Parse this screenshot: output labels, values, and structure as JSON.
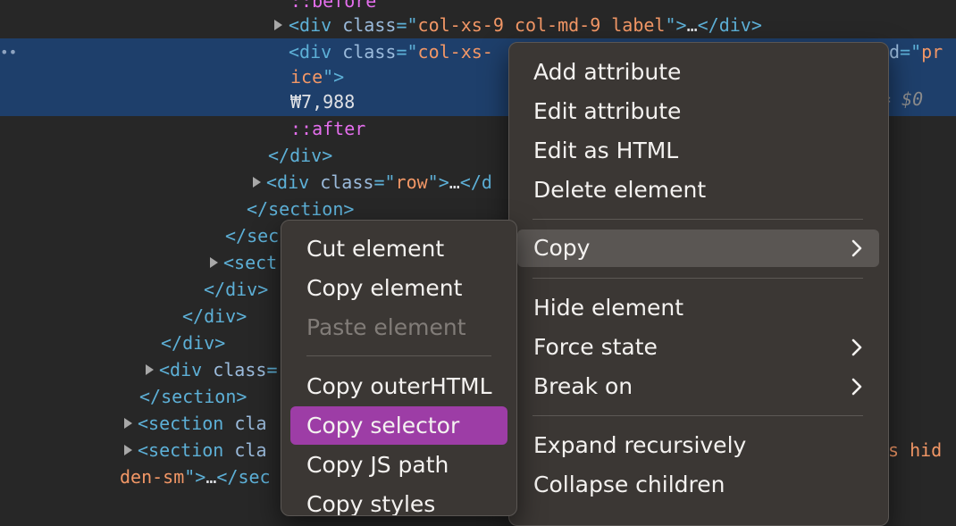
{
  "elements_tree": {
    "lines": [
      {
        "id": "l0",
        "segments": [
          {
            "t": "::before",
            "c": "pseudo"
          }
        ]
      },
      {
        "id": "l1",
        "segments": [
          {
            "t": "<div ",
            "c": "tag"
          },
          {
            "t": "class",
            "c": "attr"
          },
          {
            "t": "=\"",
            "c": "tag"
          },
          {
            "t": "col-xs-9 col-md-9 label",
            "c": "val"
          },
          {
            "t": "\">",
            "c": "tag"
          },
          {
            "t": "…",
            "c": "txt"
          },
          {
            "t": "</div>",
            "c": "tag"
          }
        ]
      },
      {
        "id": "l2",
        "segments": [
          {
            "t": "<div ",
            "c": "tag"
          },
          {
            "t": "class",
            "c": "attr"
          },
          {
            "t": "=\"",
            "c": "tag"
          },
          {
            "t": "col-xs-",
            "c": "val"
          }
        ]
      },
      {
        "id": "l2b",
        "segments": [
          {
            "t": "d",
            "c": "attr"
          },
          {
            "t": "=\"",
            "c": "tag"
          },
          {
            "t": "pr",
            "c": "val"
          }
        ]
      },
      {
        "id": "l3",
        "segments": [
          {
            "t": "ice",
            "c": "val"
          },
          {
            "t": "\">",
            "c": "tag"
          }
        ]
      },
      {
        "id": "l4",
        "segments": [
          {
            "t": "₩7,988",
            "c": "txt"
          }
        ]
      },
      {
        "id": "l5",
        "segments": [
          {
            "t": "::after",
            "c": "pseudo"
          }
        ]
      },
      {
        "id": "l6",
        "segments": [
          {
            "t": "</div>",
            "c": "tag"
          }
        ]
      },
      {
        "id": "l7",
        "segments": [
          {
            "t": "<div ",
            "c": "tag"
          },
          {
            "t": "class",
            "c": "attr"
          },
          {
            "t": "=\"",
            "c": "tag"
          },
          {
            "t": "row",
            "c": "val"
          },
          {
            "t": "\">",
            "c": "tag"
          },
          {
            "t": "…",
            "c": "txt"
          },
          {
            "t": "</d",
            "c": "tag"
          }
        ]
      },
      {
        "id": "l8",
        "segments": [
          {
            "t": "</section>",
            "c": "tag"
          }
        ]
      },
      {
        "id": "l9",
        "segments": [
          {
            "t": "</sec",
            "c": "tag"
          }
        ]
      },
      {
        "id": "l10",
        "segments": [
          {
            "t": "<sect",
            "c": "tag"
          }
        ]
      },
      {
        "id": "l11",
        "segments": [
          {
            "t": "</div>",
            "c": "tag"
          }
        ]
      },
      {
        "id": "l12",
        "segments": [
          {
            "t": "</div>",
            "c": "tag"
          }
        ]
      },
      {
        "id": "l13",
        "segments": [
          {
            "t": "</div>",
            "c": "tag"
          }
        ]
      },
      {
        "id": "l14",
        "segments": [
          {
            "t": "<div ",
            "c": "tag"
          },
          {
            "t": "class",
            "c": "attr"
          },
          {
            "t": "=",
            "c": "tag"
          }
        ]
      },
      {
        "id": "l15",
        "segments": [
          {
            "t": "</section>",
            "c": "tag"
          }
        ]
      },
      {
        "id": "l16",
        "segments": [
          {
            "t": "<section ",
            "c": "tag"
          },
          {
            "t": "cla",
            "c": "attr"
          }
        ]
      },
      {
        "id": "l17",
        "segments": [
          {
            "t": "<section ",
            "c": "tag"
          },
          {
            "t": "cla",
            "c": "attr"
          }
        ]
      },
      {
        "id": "l17b",
        "segments": [
          {
            "t": "s hid",
            "c": "val"
          }
        ]
      },
      {
        "id": "l18",
        "segments": [
          {
            "t": "den-sm",
            "c": "val"
          },
          {
            "t": "\">",
            "c": "tag"
          },
          {
            "t": "…",
            "c": "txt"
          },
          {
            "t": "</sec",
            "c": "tag"
          }
        ]
      }
    ],
    "selected_suffix": "= $0"
  },
  "context_menu": {
    "items": [
      {
        "label": "Add attribute"
      },
      {
        "label": "Edit attribute"
      },
      {
        "label": "Edit as HTML"
      },
      {
        "label": "Delete element"
      },
      {
        "label": "Copy",
        "has_submenu": true,
        "state": "hover"
      },
      {
        "label": "Hide element"
      },
      {
        "label": "Force state",
        "has_submenu": true
      },
      {
        "label": "Break on",
        "has_submenu": true
      },
      {
        "label": "Expand recursively"
      },
      {
        "label": "Collapse children"
      }
    ]
  },
  "copy_submenu": {
    "items": [
      {
        "label": "Cut element"
      },
      {
        "label": "Copy element"
      },
      {
        "label": "Paste element",
        "disabled": true
      },
      {
        "label": "Copy outerHTML"
      },
      {
        "label": "Copy selector",
        "state": "active"
      },
      {
        "label": "Copy JS path"
      },
      {
        "label": "Copy styles"
      }
    ]
  },
  "colors": {
    "background": "#272727",
    "selected_row": "#1e3f6b",
    "tag": "#5db0d7",
    "attribute": "#9bbbdc",
    "value": "#f29766",
    "pseudo": "#e36eec",
    "menu_bg": "#3b3734",
    "menu_hover": "#5a5653",
    "menu_active": "#9d3da6"
  }
}
